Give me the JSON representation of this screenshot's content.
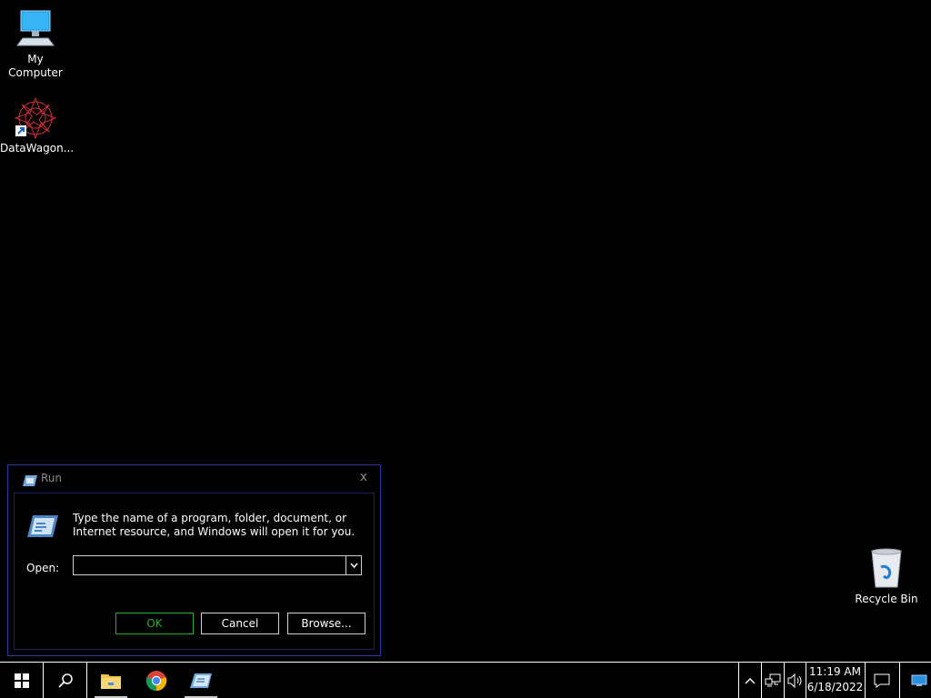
{
  "desktop": {
    "icons": [
      {
        "label": "My Computer",
        "icon": "computer-icon"
      },
      {
        "label": "DataWagon...",
        "icon": "datawagon-shortcut-icon"
      },
      {
        "label": "Recycle Bin",
        "icon": "recycle-bin-icon"
      }
    ]
  },
  "run_dialog": {
    "title": "Run",
    "close_glyph": "x",
    "description": "Type the name of a program, folder, document, or Internet resource, and Windows will open it for you.",
    "open_label": "Open:",
    "open_value": "",
    "ok_label": "OK",
    "cancel_label": "Cancel",
    "browse_label": "Browse..."
  },
  "taskbar": {
    "apps": [
      {
        "name": "File Explorer",
        "icon": "folder-icon"
      },
      {
        "name": "Google Chrome",
        "icon": "chrome-icon"
      },
      {
        "name": "Run",
        "icon": "run-icon"
      }
    ],
    "clock": {
      "time": "11:19 AM",
      "date": "6/18/2022"
    }
  },
  "colors": {
    "background": "#000000",
    "taskbar_border": "#ffffff",
    "dialog_border": "#2a3a9a",
    "ok_button": "#2eaa2e"
  }
}
